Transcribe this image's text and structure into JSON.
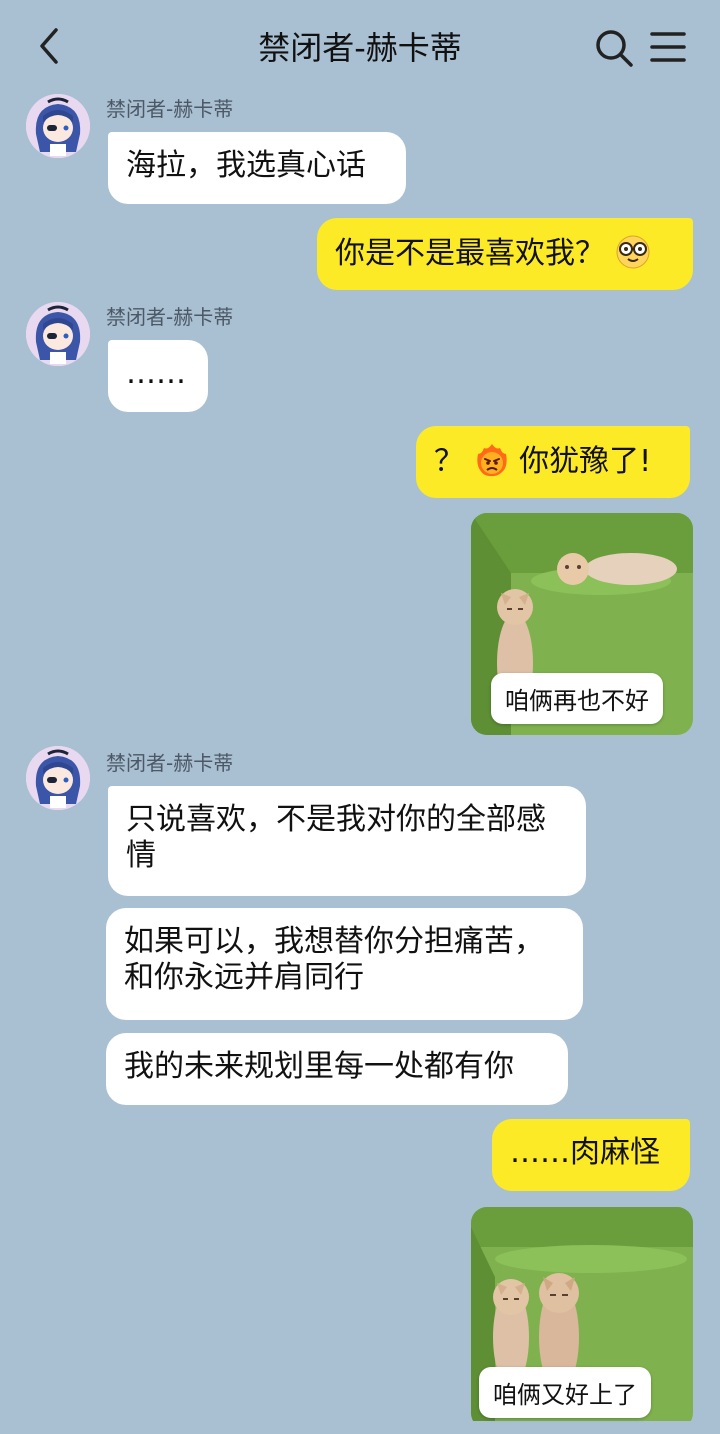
{
  "header": {
    "title": "禁闭者-赫卡蒂",
    "back_icon": "chevron-left-icon",
    "search_icon": "search-icon",
    "menu_icon": "hamburger-menu-icon"
  },
  "colors": {
    "background": "#a9bfd2",
    "incoming_bubble": "#ffffff",
    "outgoing_bubble": "#fdea26"
  },
  "messages": [
    {
      "sender": "禁闭者-赫卡蒂",
      "text": "海拉，我选真心话"
    },
    {
      "text": "你是不是最喜欢我？",
      "emoji": "nerd-glasses-emoji"
    },
    {
      "sender": "禁闭者-赫卡蒂",
      "text": "……"
    },
    {
      "prefix": "？",
      "emoji": "angry-fire-emoji",
      "text": "你犹豫了!"
    },
    {
      "sticker": "cats-lying-apart",
      "caption": "咱俩再也不好"
    },
    {
      "sender": "禁闭者-赫卡蒂",
      "text": "只说喜欢，不是我对你的全部感情"
    },
    {
      "text": "如果可以，我想替你分担痛苦，和你永远并肩同行"
    },
    {
      "text": "我的未来规划里每一处都有你"
    },
    {
      "text": "……肉麻怪"
    },
    {
      "sticker": "cats-lying-together",
      "caption": "咱俩又好上了"
    }
  ]
}
